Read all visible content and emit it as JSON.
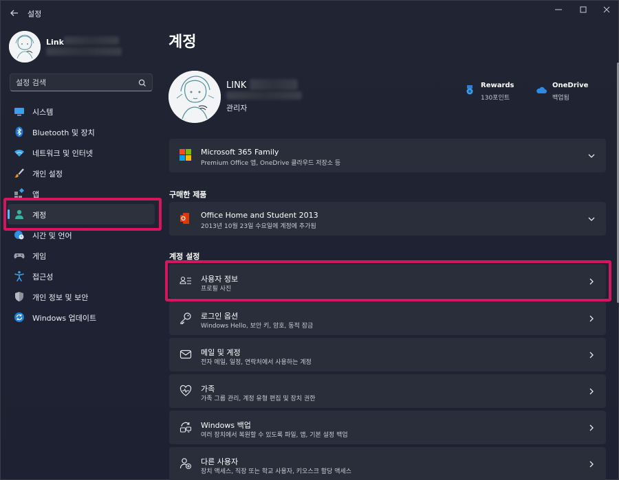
{
  "window": {
    "title": "설정",
    "back_icon": "back-arrow-icon",
    "controls": [
      "minimize-icon",
      "maximize-icon",
      "close-icon"
    ]
  },
  "sidebar": {
    "user_name": "Link",
    "search": {
      "placeholder": "설정 검색",
      "icon": "search-icon"
    },
    "items": [
      {
        "label": "시스템",
        "icon": "monitor-icon"
      },
      {
        "label": "Bluetooth 및 장치",
        "icon": "bluetooth-icon"
      },
      {
        "label": "네트워크 및 인터넷",
        "icon": "wifi-icon"
      },
      {
        "label": "개인 설정",
        "icon": "brush-icon"
      },
      {
        "label": "앱",
        "icon": "apps-icon"
      },
      {
        "label": "계정",
        "icon": "person-icon",
        "active": true
      },
      {
        "label": "시간 및 언어",
        "icon": "globe-clock-icon"
      },
      {
        "label": "게임",
        "icon": "gamepad-icon"
      },
      {
        "label": "접근성",
        "icon": "accessibility-icon"
      },
      {
        "label": "개인 정보 및 보안",
        "icon": "shield-icon"
      },
      {
        "label": "Windows 업데이트",
        "icon": "update-icon"
      }
    ]
  },
  "main": {
    "title": "계정",
    "profile": {
      "name": "LINK",
      "role": "관리자",
      "services": [
        {
          "title": "Rewards",
          "sub": "130포인트",
          "icon": "rewards-medal-icon"
        },
        {
          "title": "OneDrive",
          "sub": "백업됨",
          "icon": "onedrive-cloud-icon"
        }
      ]
    },
    "m365": {
      "title": "Microsoft 365 Family",
      "sub": "Premium Office 앱, OneDrive 클라우드 저장소 등"
    },
    "purchased_label": "구매한 제품",
    "office": {
      "title": "Office Home and Student 2013",
      "sub": "2013년 10월 23일 수요일에 계정에 추가됨"
    },
    "settings_label": "계정 설정",
    "settings": [
      {
        "title": "사용자 정보",
        "sub": "프로필 사진",
        "icon": "user-info-icon"
      },
      {
        "title": "로그인 옵션",
        "sub": "Windows Hello, 보안 키, 암호, 동적 잠금",
        "icon": "key-icon"
      },
      {
        "title": "메일 및 계정",
        "sub": "전자 메일, 일정, 연락처에서 사용하는 계정",
        "icon": "mail-icon"
      },
      {
        "title": "가족",
        "sub": "가족 그룹 관리, 계정 유형 편집 및 장치 권한",
        "icon": "family-heart-icon"
      },
      {
        "title": "Windows 백업",
        "sub": "여러 장치에서 복원할 수 있도록 파일, 앱, 기본 설정 백업",
        "icon": "backup-icon"
      },
      {
        "title": "다른 사용자",
        "sub": "장치 액세스, 직장 또는 학교 사용자, 키오스크 할당 액세스",
        "icon": "add-user-icon"
      }
    ]
  },
  "colors": {
    "accent": "#4cc2ff",
    "highlight": "#d6155f",
    "background": "#202433",
    "card": "#2a2e3a"
  }
}
